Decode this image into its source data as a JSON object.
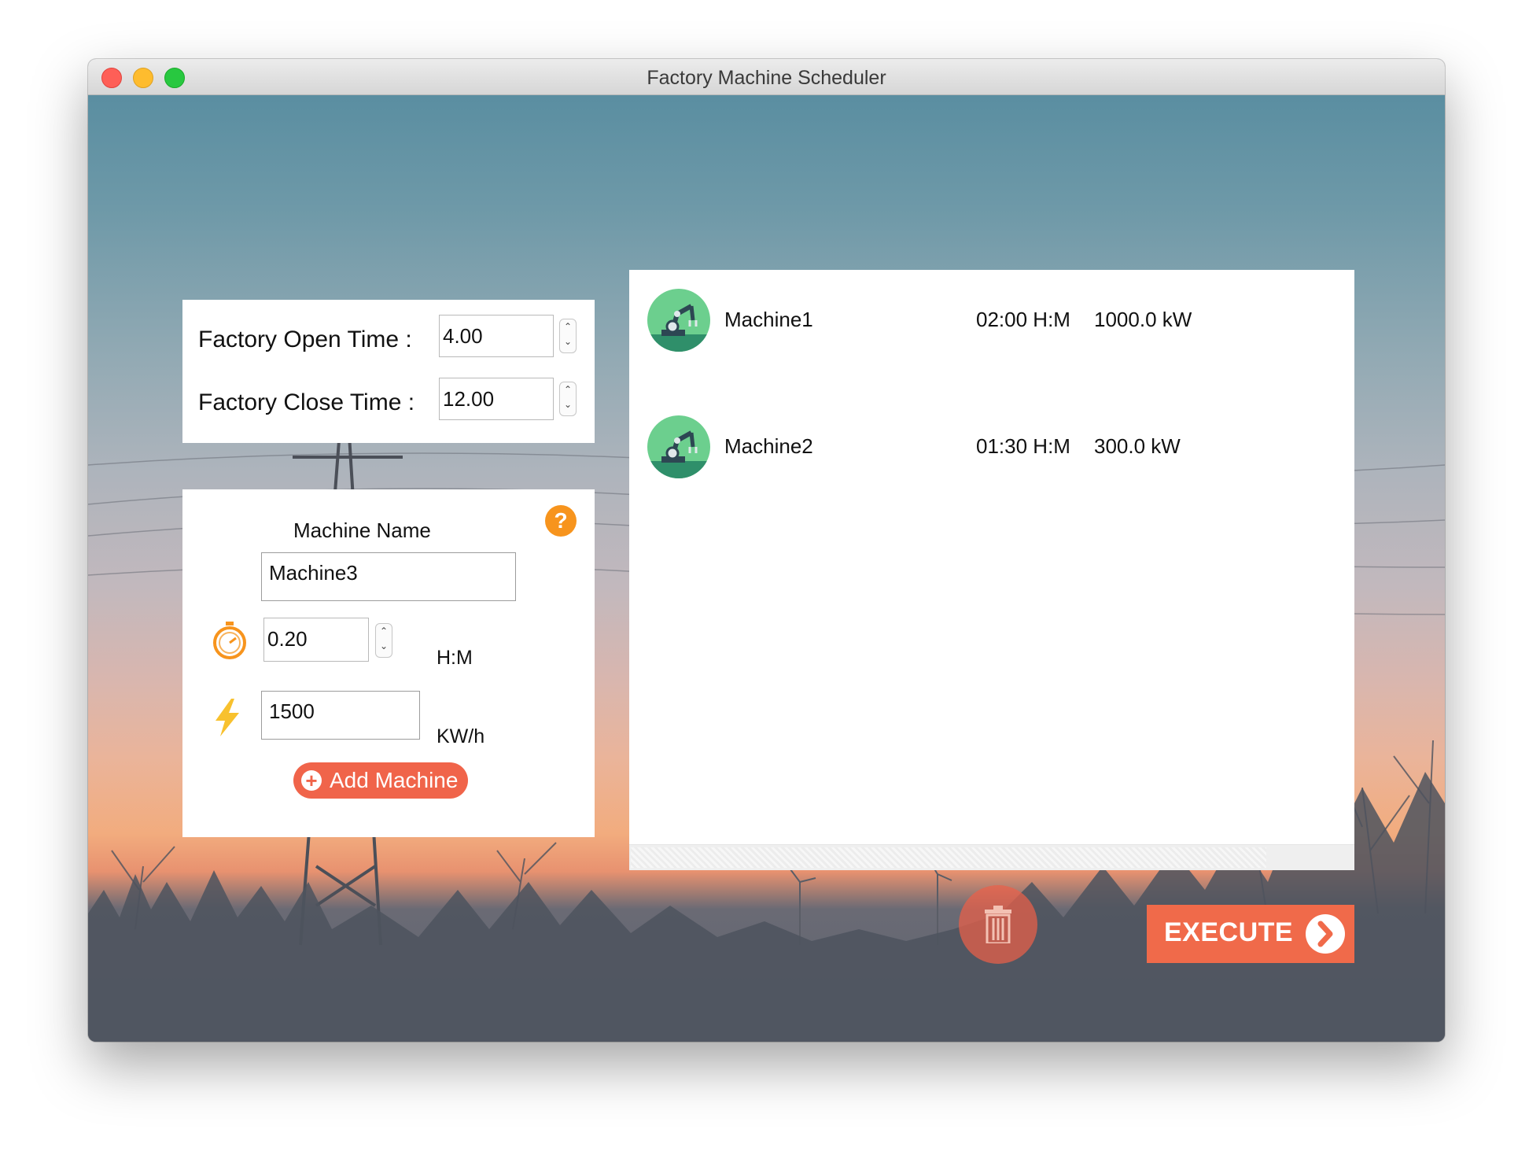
{
  "window": {
    "title": "Factory Machine Scheduler"
  },
  "schedule": {
    "open_label": "Factory Open Time :",
    "open_value": "4.00",
    "close_label": "Factory Close Time :",
    "close_value": "12.00"
  },
  "machine_form": {
    "name_label": "Machine Name",
    "help_symbol": "?",
    "name_value": "Machine3",
    "duration_value": "0.20",
    "duration_unit": "H:M",
    "power_value": "1500",
    "power_unit": "KW/h",
    "add_label": "Add Machine",
    "add_symbol": "+"
  },
  "machines": [
    {
      "name": "Machine1",
      "duration": "02:00 H:M",
      "power": "1000.0 kW",
      "icon": "robot-arm-icon"
    },
    {
      "name": "Machine2",
      "duration": "01:30 H:M",
      "power": "300.0 kW",
      "icon": "robot-arm-icon"
    }
  ],
  "actions": {
    "execute_label": "EXECUTE",
    "delete_icon": "trash-icon"
  },
  "colors": {
    "accent": "#f0644a",
    "help": "#f7941d",
    "avatar": "#6ccf8e"
  }
}
